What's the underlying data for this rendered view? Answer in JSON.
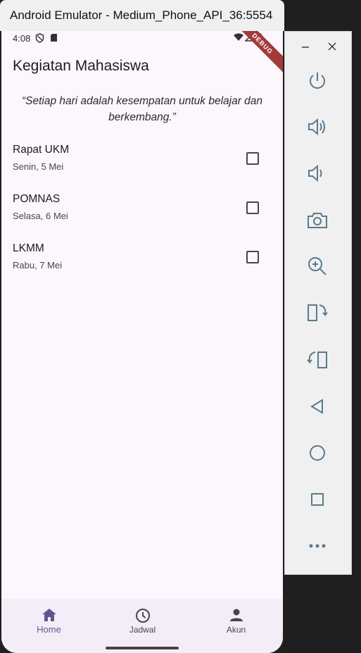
{
  "window": {
    "title": "Android Emulator - Medium_Phone_API_36:5554"
  },
  "status_bar": {
    "time": "4:08",
    "debug_label": "DEBUG"
  },
  "app": {
    "title": "Kegiatan Mahasiswa",
    "quote": "“Setiap hari adalah kesempatan untuk belajar dan berkembang.”",
    "activities": [
      {
        "name": "Rapat UKM",
        "date": "Senin, 5 Mei",
        "checked": false
      },
      {
        "name": "POMNAS",
        "date": "Selasa, 6 Mei",
        "checked": false
      },
      {
        "name": "LKMM",
        "date": "Rabu, 7 Mei",
        "checked": false
      }
    ],
    "bottom_nav": [
      {
        "label": "Home",
        "icon": "home-icon",
        "active": true
      },
      {
        "label": "Jadwal",
        "icon": "clock-icon",
        "active": false
      },
      {
        "label": "Akun",
        "icon": "person-icon",
        "active": false
      }
    ]
  },
  "colors": {
    "accent": "#65558f",
    "background": "#fcf6fd",
    "nav_background": "#f3edf7",
    "toolbar_icon": "#5b7a8c"
  },
  "emulator_toolbar": {
    "tools": [
      "power-icon",
      "volume-up-icon",
      "volume-down-icon",
      "camera-icon",
      "zoom-icon",
      "rotate-left-icon",
      "rotate-right-icon",
      "back-icon",
      "home-circle-icon",
      "overview-icon",
      "more-icon"
    ]
  }
}
